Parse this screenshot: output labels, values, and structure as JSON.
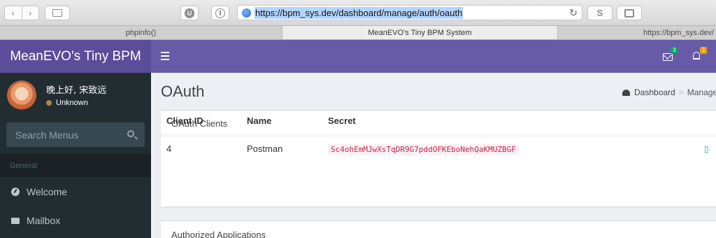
{
  "browser": {
    "url": "https://bpm_sys.dev/dashboard/manage/auth/oauth",
    "s_button": "S",
    "ext_u": "U",
    "tabs": [
      "phpinfo()",
      "MeanEVO's Tiny BPM System",
      "https://bpm_sys.dev/"
    ]
  },
  "header": {
    "logo": "MeanEVO's Tiny BPM",
    "mail_count": "3",
    "notification_count": "1"
  },
  "sidebar": {
    "user_name": "晚上好, 宋致远",
    "user_status": "Unknown",
    "search_placeholder": "Search Menus",
    "section_header": "General",
    "items": [
      {
        "label": "Welcome",
        "icon": "dashboard-icon"
      },
      {
        "label": "Mailbox",
        "icon": "envelope-icon"
      }
    ]
  },
  "main": {
    "page_title": "OAuth",
    "breadcrumb": [
      "Dashboard",
      "Manage"
    ],
    "clients_box": {
      "title": "OAuth Clients",
      "columns": [
        "Client ID",
        "Name",
        "Secret"
      ],
      "rows": [
        {
          "id": "4",
          "name": "Postman",
          "secret": "Sc4ohEmMJwXsTqDR9G7pddOFKEboNehQaKMUZBGF"
        }
      ]
    },
    "authorized_box": {
      "title": "Authorized Applications"
    }
  },
  "colors": {
    "logo_bg": "#5b4d99",
    "navbar_bg": "#675ba8",
    "sidebar_bg": "#222d32",
    "secret_text": "#c7254e"
  }
}
